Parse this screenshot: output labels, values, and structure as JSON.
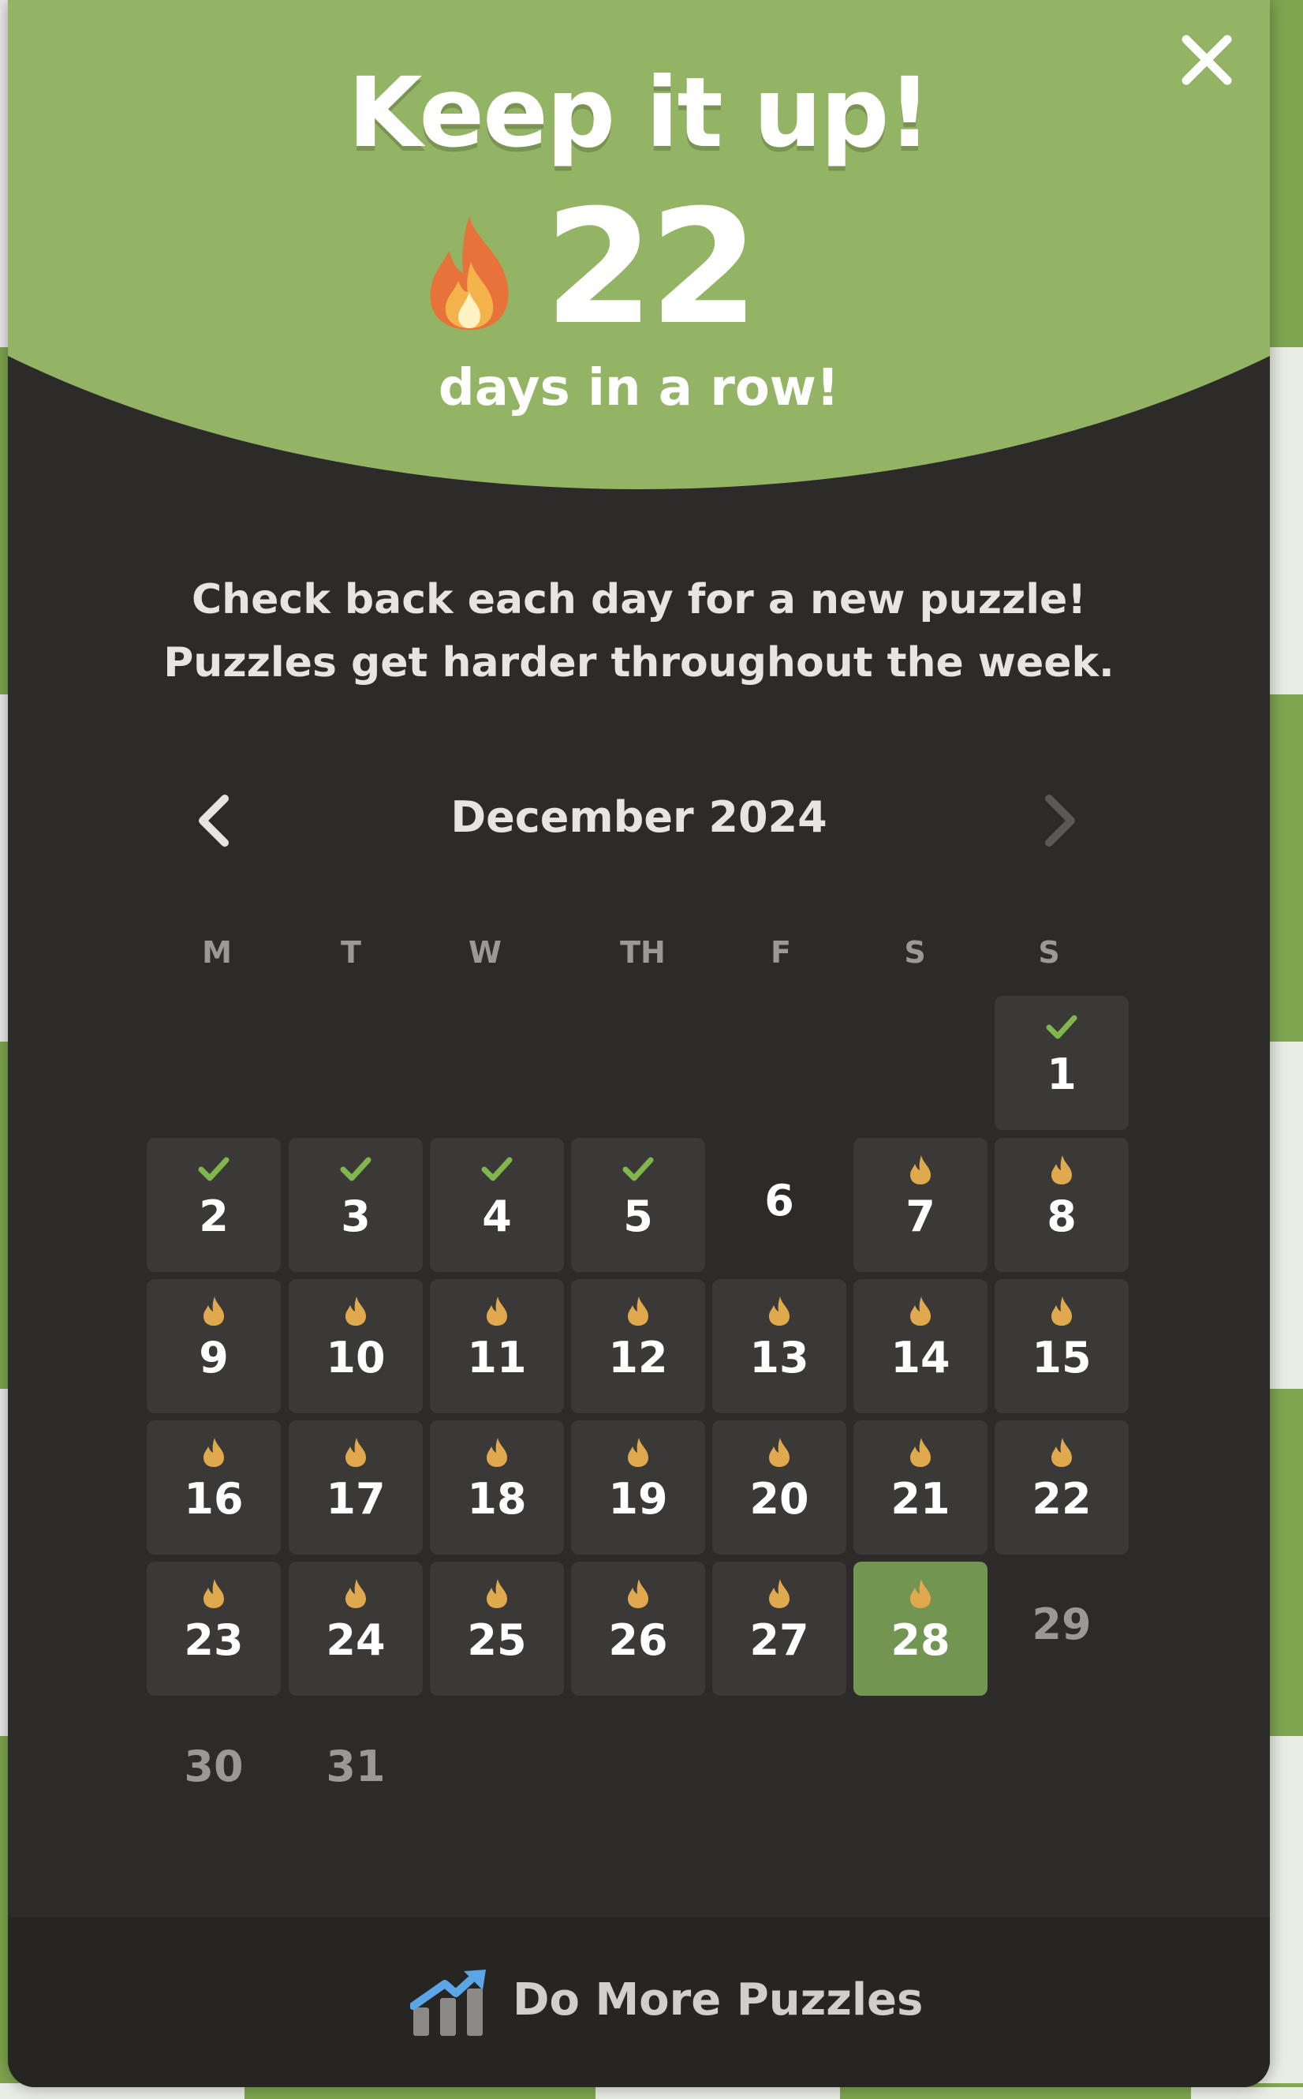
{
  "header": {
    "title": "Keep it up!",
    "streak_count": "22",
    "streak_caption": "days in a row!"
  },
  "message": {
    "line1": "Check back each day for a new puzzle!",
    "line2": "Puzzles get harder throughout the week."
  },
  "calendar": {
    "month_label": "December 2024",
    "weekdays": [
      "M",
      "T",
      "W",
      "TH",
      "F",
      "S",
      "S"
    ],
    "days": [
      {
        "label": "1",
        "status": "solved"
      },
      {
        "label": "2",
        "status": "solved"
      },
      {
        "label": "3",
        "status": "solved"
      },
      {
        "label": "4",
        "status": "solved"
      },
      {
        "label": "5",
        "status": "solved"
      },
      {
        "label": "6",
        "status": "missed"
      },
      {
        "label": "7",
        "status": "streak"
      },
      {
        "label": "8",
        "status": "streak"
      },
      {
        "label": "9",
        "status": "streak"
      },
      {
        "label": "10",
        "status": "streak"
      },
      {
        "label": "11",
        "status": "streak"
      },
      {
        "label": "12",
        "status": "streak"
      },
      {
        "label": "13",
        "status": "streak"
      },
      {
        "label": "14",
        "status": "streak"
      },
      {
        "label": "15",
        "status": "streak"
      },
      {
        "label": "16",
        "status": "streak"
      },
      {
        "label": "17",
        "status": "streak"
      },
      {
        "label": "18",
        "status": "streak"
      },
      {
        "label": "19",
        "status": "streak"
      },
      {
        "label": "20",
        "status": "streak"
      },
      {
        "label": "21",
        "status": "streak"
      },
      {
        "label": "22",
        "status": "streak"
      },
      {
        "label": "23",
        "status": "streak"
      },
      {
        "label": "24",
        "status": "streak"
      },
      {
        "label": "25",
        "status": "streak"
      },
      {
        "label": "26",
        "status": "streak"
      },
      {
        "label": "27",
        "status": "streak"
      },
      {
        "label": "28",
        "status": "today"
      },
      {
        "label": "29",
        "status": "future"
      },
      {
        "label": "30",
        "status": "future"
      },
      {
        "label": "31",
        "status": "future"
      }
    ]
  },
  "footer": {
    "button_label": "Do More Puzzles",
    "icon": "chart-arrow-icon"
  },
  "colors": {
    "header_green": "#93b464",
    "modal_bg": "#2c2b29",
    "cell_bg": "#3a3937",
    "today_bg": "#739552",
    "check_green": "#81b64c",
    "flame_gold": "#e0a94e",
    "flame_orange": "#e8733a"
  }
}
